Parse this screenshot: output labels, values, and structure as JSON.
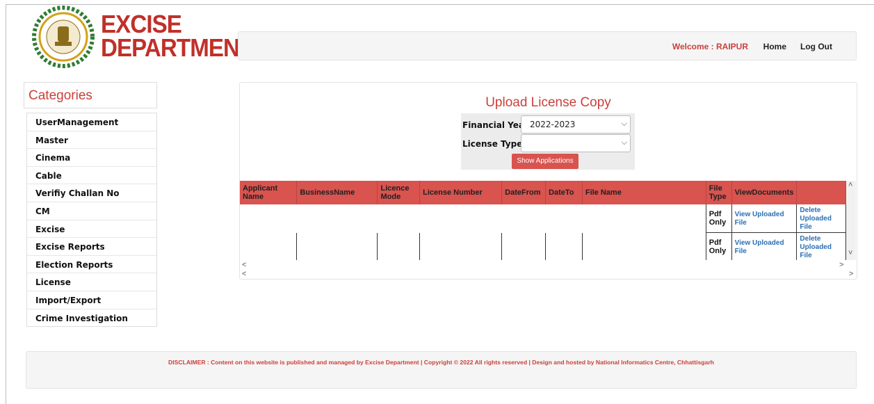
{
  "logo": {
    "line1": "EXCISE",
    "line2": "DEPARTMENT"
  },
  "header": {
    "welcome": "Welcome : RAIPUR",
    "home": "Home",
    "logout": "Log Out"
  },
  "sidebar": {
    "title": "Categories",
    "items": [
      {
        "label": "UserManagement"
      },
      {
        "label": "Master"
      },
      {
        "label": "Cinema"
      },
      {
        "label": "Cable"
      },
      {
        "label": "Verifiy Challan No"
      },
      {
        "label": "CM"
      },
      {
        "label": "Excise"
      },
      {
        "label": "Excise Reports"
      },
      {
        "label": "Election Reports"
      },
      {
        "label": "License"
      },
      {
        "label": "Import/Export"
      },
      {
        "label": "Crime Investigation"
      }
    ]
  },
  "main": {
    "title": "Upload License Copy",
    "form": {
      "fy_label": "Financial Year :",
      "fy_value": "2022-2023",
      "lt_label": "License Type :",
      "lt_value": "",
      "button": "Show Applications"
    },
    "table": {
      "headers": [
        "Applicant Name",
        "BusinessName",
        "Licence Mode",
        "License Number",
        "DateFrom",
        "DateTo",
        "File Name",
        "File Type",
        "ViewDocuments",
        ""
      ],
      "rows": [
        {
          "file_type": "Pdf Only",
          "view": "View Uploaded File",
          "delete": "Delete Uploaded File"
        },
        {
          "file_type": "Pdf Only",
          "view": "View Uploaded File",
          "delete": "Delete Uploaded File"
        }
      ]
    }
  },
  "footer": {
    "disclaimer": "DISCLAIMER : Content on this website is published and managed by Excise Department | Copyright © 2022 All rights reserved | Design and hosted by National Informatics Centre, Chhattisgarh"
  },
  "colors": {
    "accent": "#d9534f",
    "title_red": "#c9403a",
    "link": "#2a6fb5"
  }
}
